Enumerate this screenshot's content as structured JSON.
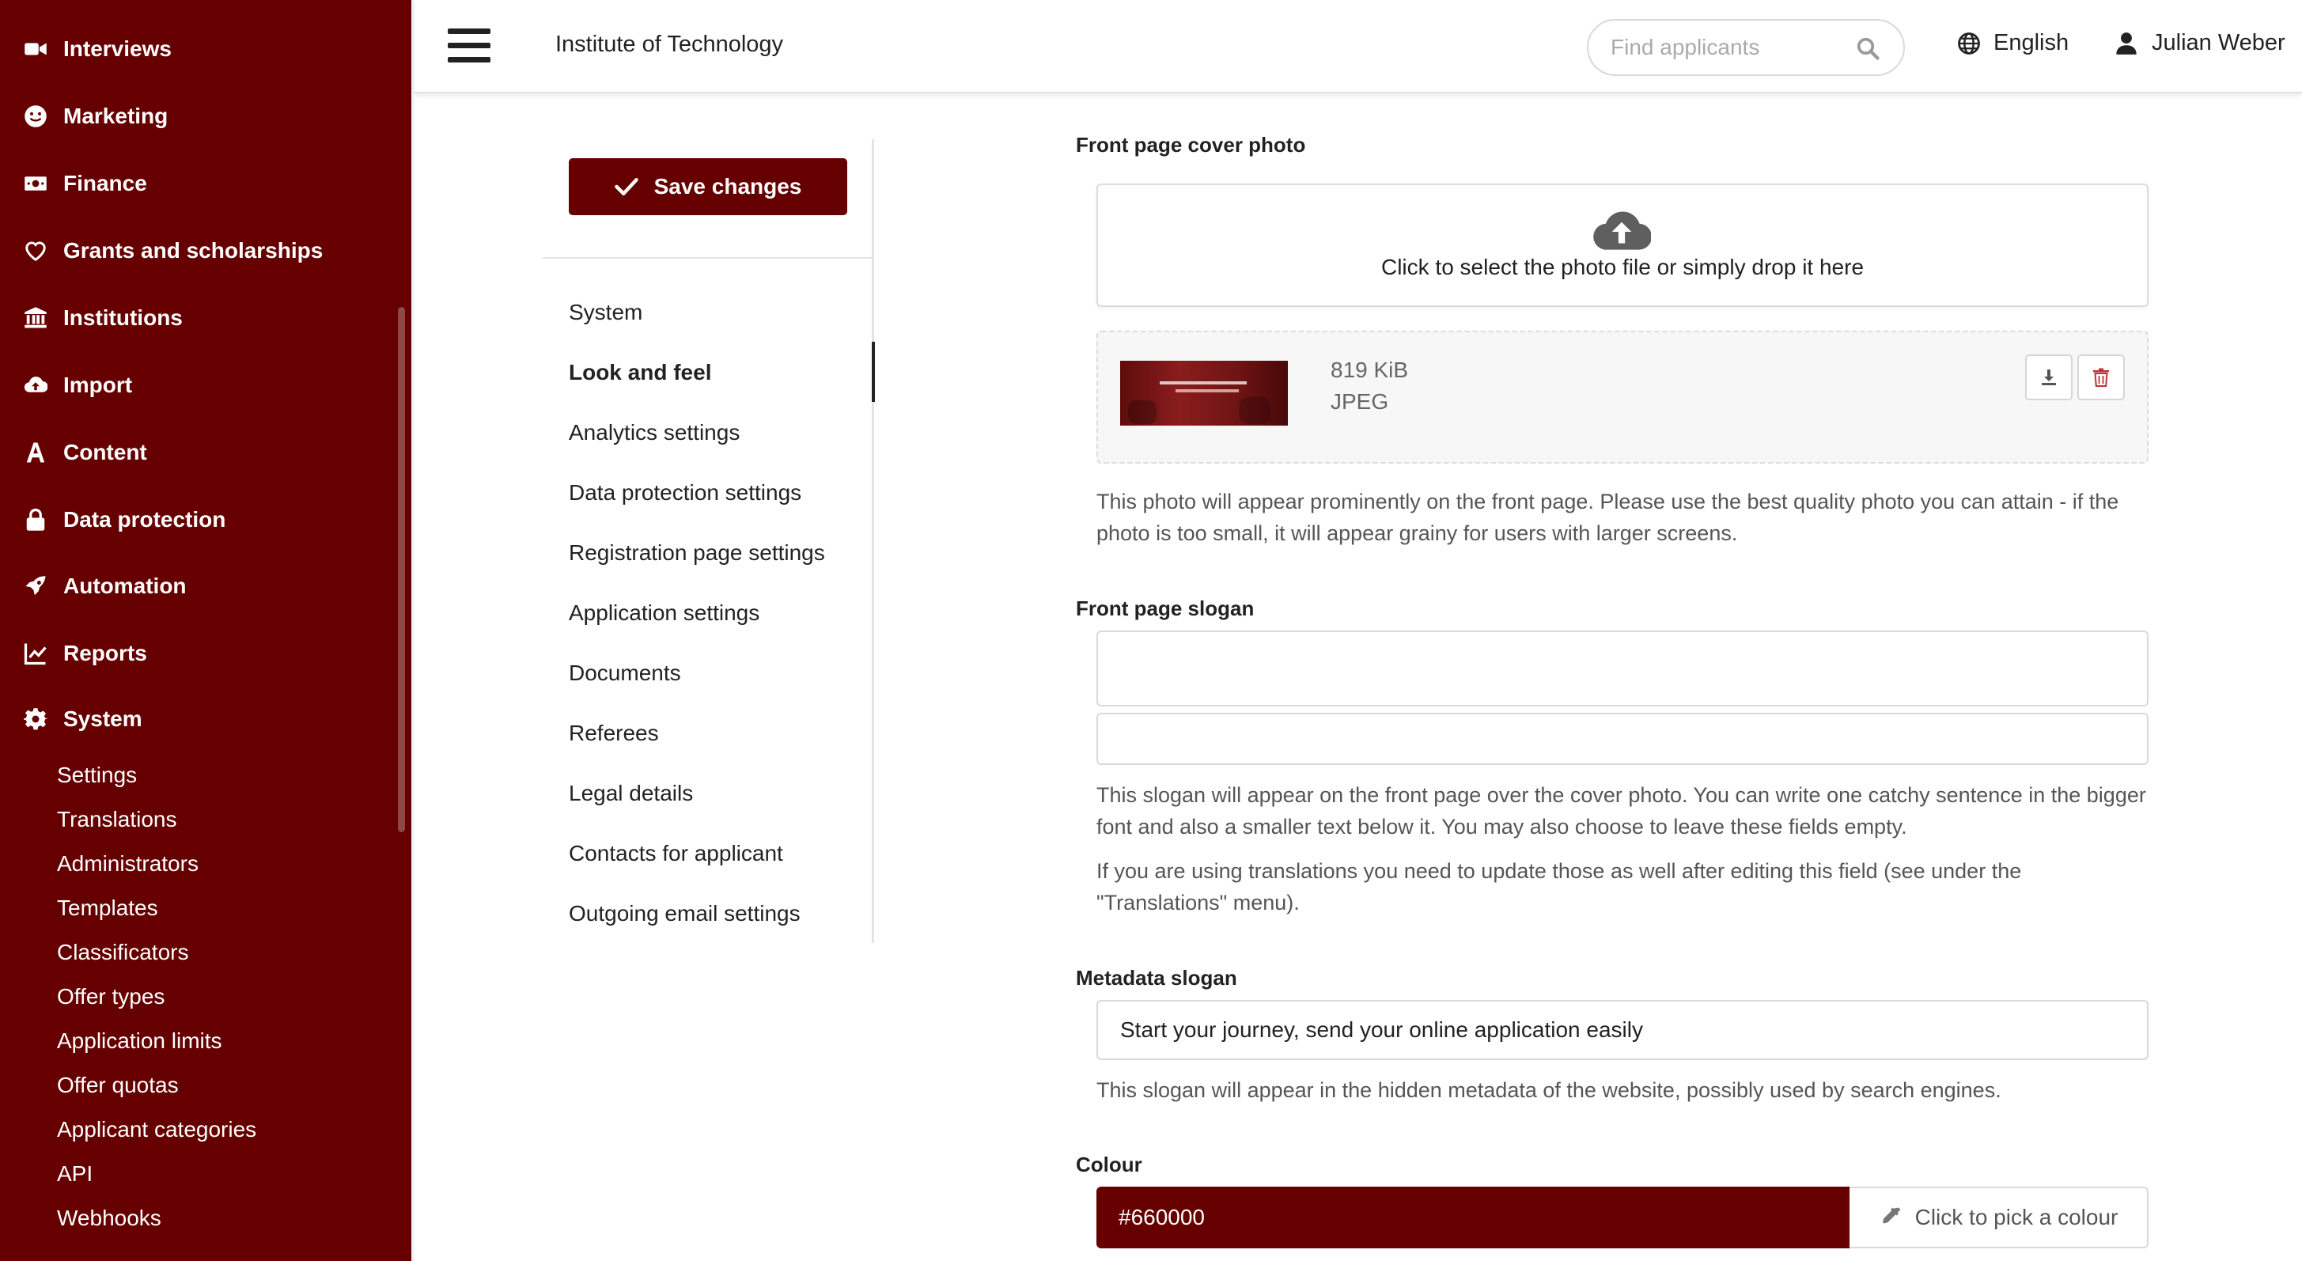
{
  "colors": {
    "brand": "#660000",
    "sidebar_text": "#ffffff",
    "help_text": "#555555"
  },
  "sidebar": {
    "items": [
      {
        "label": "Interviews",
        "icon": "video-camera-icon"
      },
      {
        "label": "Marketing",
        "icon": "smiley-icon"
      },
      {
        "label": "Finance",
        "icon": "money-bill-icon"
      },
      {
        "label": "Grants and scholarships",
        "icon": "heart-icon"
      },
      {
        "label": "Institutions",
        "icon": "building-columns-icon"
      },
      {
        "label": "Import",
        "icon": "cloud-upload-icon"
      },
      {
        "label": "Content",
        "icon": "font-letter-icon"
      },
      {
        "label": "Data protection",
        "icon": "lock-icon"
      },
      {
        "label": "Automation",
        "icon": "rocket-icon"
      },
      {
        "label": "Reports",
        "icon": "line-chart-icon"
      },
      {
        "label": "System",
        "icon": "gear-icon"
      }
    ],
    "system_subitems": [
      "Settings",
      "Translations",
      "Administrators",
      "Templates",
      "Classificators",
      "Offer types",
      "Application limits",
      "Offer quotas",
      "Applicant categories",
      "API",
      "Webhooks"
    ]
  },
  "header": {
    "org_name": "Institute of Technology",
    "search_placeholder": "Find applicants",
    "language": "English",
    "user_name": "Julian Weber"
  },
  "settings_menu": {
    "save_label": "Save changes",
    "items": [
      "System",
      "Look and feel",
      "Analytics settings",
      "Data protection settings",
      "Registration page settings",
      "Application settings",
      "Documents",
      "Referees",
      "Legal details",
      "Contacts for applicant",
      "Outgoing email settings"
    ],
    "active_item": "Look and feel"
  },
  "form": {
    "cover_photo": {
      "label": "Front page cover photo",
      "dropzone_text": "Click to select the photo file or simply drop it here",
      "file_size": "819 KiB",
      "file_type": "JPEG",
      "help": "This photo will appear prominently on the front page. Please use the best quality photo you can attain - if the photo is too small, it will appear grainy for users with larger screens."
    },
    "slogan": {
      "label": "Front page slogan",
      "main_value": "",
      "sub_value": "",
      "help_1": "This slogan will appear on the front page over the cover photo. You can write one catchy sentence in the bigger font and also a smaller text below it. You may also choose to leave these fields empty.",
      "help_2": "If you are using translations you need to update those as well after editing this field (see under the \"Translations\" menu)."
    },
    "metadata_slogan": {
      "label": "Metadata slogan",
      "value": "Start your journey, send your online application easily",
      "help": "This slogan will appear in the hidden metadata of the website, possibly used by search engines."
    },
    "colour": {
      "label": "Colour",
      "value": "#660000",
      "picker_label": "Click to pick a colour"
    }
  }
}
